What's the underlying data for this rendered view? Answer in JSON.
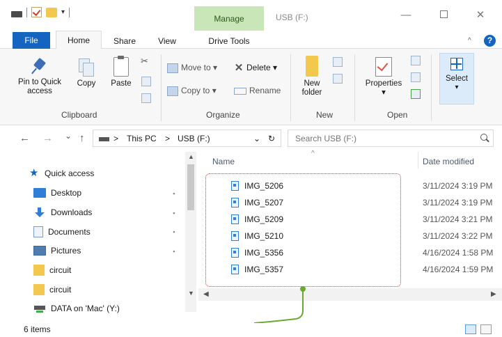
{
  "window": {
    "title": "USB (F:)",
    "context_tab": "Manage",
    "minimize_glyph": "—",
    "close_glyph": "✕",
    "qat_arrow": "▾"
  },
  "ribbon_tabs": {
    "file": "File",
    "home": "Home",
    "share": "Share",
    "view": "View",
    "drive_tools": "Drive Tools",
    "collapse_glyph": "^",
    "help_glyph": "?"
  },
  "clipboard": {
    "pin_line1": "Pin to Quick",
    "pin_line2": "access",
    "copy": "Copy",
    "paste": "Paste",
    "label": "Clipboard"
  },
  "organize": {
    "move_to": "Move to",
    "copy_to": "Copy to",
    "delete": "Delete",
    "rename": "Rename",
    "dropdown": "▾",
    "label": "Organize"
  },
  "new_group": {
    "new_folder_line1": "New",
    "new_folder_line2": "folder",
    "label": "New"
  },
  "open_group": {
    "properties": "Properties",
    "label": "Open"
  },
  "select_group": {
    "select": "Select"
  },
  "address": {
    "back": "←",
    "forward": "→",
    "recent": "⌄",
    "up": "↑",
    "sep": ">",
    "crumbs": [
      "This PC",
      "USB (F:)"
    ],
    "dropdown": "⌄",
    "refresh": "↻"
  },
  "search": {
    "placeholder": "Search USB (F:)"
  },
  "nav_pane": {
    "quick_access": "Quick access",
    "items": [
      "Desktop",
      "Downloads",
      "Documents",
      "Pictures",
      "circuit",
      "circuit",
      "DATA on 'Mac' (Y:)"
    ],
    "pin_glyph": "📌"
  },
  "file_list": {
    "columns": {
      "name": "Name",
      "date": "Date modified"
    },
    "sort_glyph": "^",
    "files": [
      {
        "name": "IMG_5206",
        "date": "3/11/2024 3:19 PM"
      },
      {
        "name": "IMG_5207",
        "date": "3/11/2024 3:19 PM"
      },
      {
        "name": "IMG_5209",
        "date": "3/11/2024 3:21 PM"
      },
      {
        "name": "IMG_5210",
        "date": "3/11/2024 3:22 PM"
      },
      {
        "name": "IMG_5356",
        "date": "4/16/2024 1:58 PM"
      },
      {
        "name": "IMG_5357",
        "date": "4/16/2024 1:59 PM"
      }
    ]
  },
  "status": {
    "item_count": "6 items"
  },
  "colors": {
    "accent": "#1565c0",
    "manage_tab_bg": "#c8e6b8",
    "selection_outline": "#d93030",
    "callout_line": "#6aa832"
  }
}
